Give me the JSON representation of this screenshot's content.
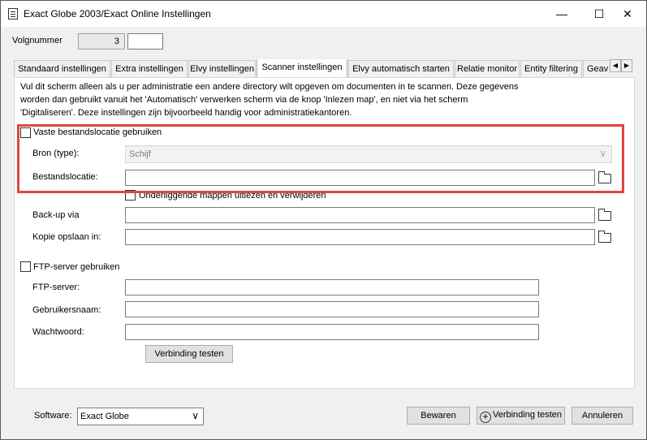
{
  "window": {
    "title": "Exact Globe 2003/Exact Online Instellingen"
  },
  "volgnummer": {
    "label": "Volgnummer",
    "value": "3",
    "extra": ""
  },
  "tabs": [
    "Standaard instellingen",
    "Extra instellingen",
    "Elvy instellingen",
    "Scanner instellingen",
    "Elvy automatisch starten",
    "Relatie monitor",
    "Entity filtering",
    "Geav"
  ],
  "active_tab": "Scanner instellingen",
  "description": {
    "line1": "Vul dit scherm alleen als u per administratie een andere directory wilt opgeven om documenten in te scannen. Deze gegevens",
    "line2": "worden dan gebruikt vanuit het 'Automatisch' verwerken scherm via de knop 'Inlezen map', en niet via het scherm",
    "line3": "'Digitaliseren'. Deze instellingen zijn bijvoorbeeld handig voor administratiekantoren."
  },
  "vaste": {
    "checkbox_label": "Vaste bestandslocatie gebruiken",
    "bron_label": "Bron (type):",
    "bron_value": "Schijf",
    "locatie_label": "Bestandslocatie:",
    "locatie_value": "",
    "sub_label": "Onderliggende mappen uitlezen en verwijderen"
  },
  "backup": {
    "label": "Back-up via",
    "value": ""
  },
  "kopie": {
    "label": "Kopie opslaan in:",
    "value": ""
  },
  "ftp": {
    "checkbox_label": "FTP-server gebruiken",
    "server_label": "FTP-server:",
    "server_value": "",
    "user_label": "Gebruikersnaam:",
    "user_value": "",
    "pass_label": "Wachtwoord:",
    "pass_value": "",
    "test_button": "Verbinding testen"
  },
  "footer": {
    "software_label": "Software:",
    "software_value": "Exact Globe",
    "save_button": "Bewaren",
    "test_button": "Verbinding testen",
    "cancel_button": "Annuleren"
  },
  "colors": {
    "highlight": "#e0463f"
  }
}
